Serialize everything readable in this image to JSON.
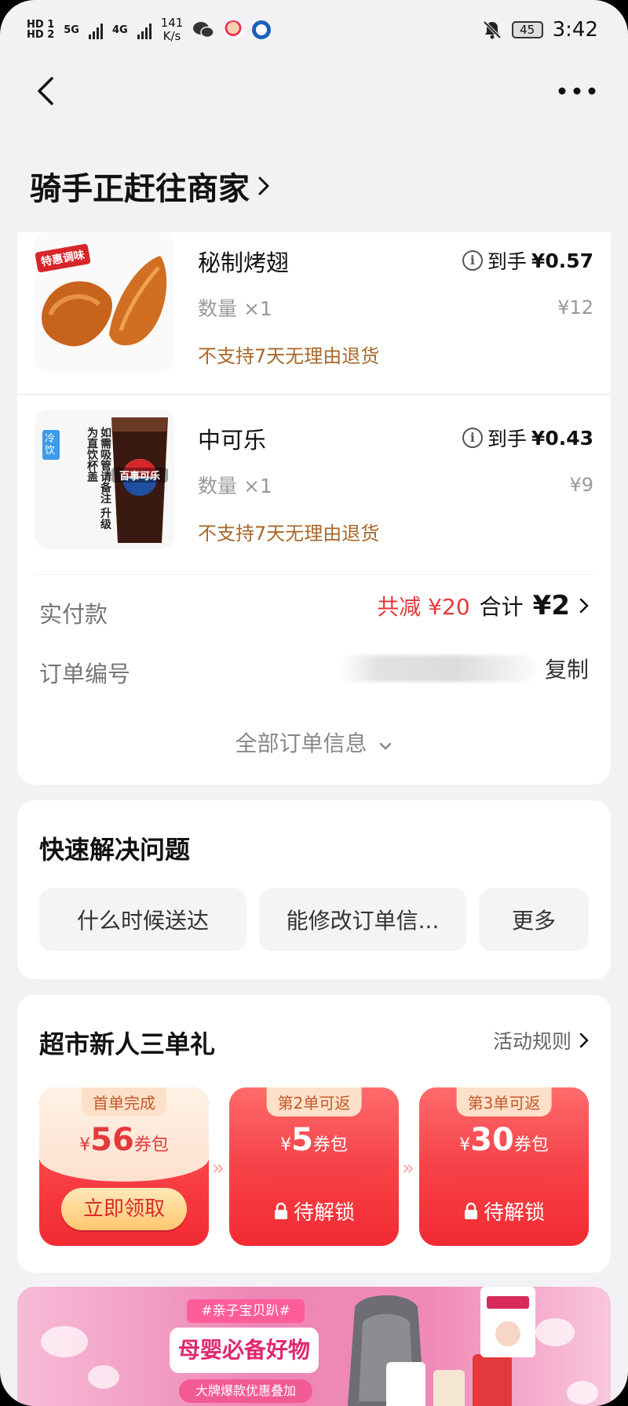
{
  "status_bar": {
    "hd1": "HD 1",
    "hd2": "HD 2",
    "net1": "5G",
    "net2": "4G",
    "speed_value": "141",
    "speed_unit": "K/s",
    "battery": "45",
    "time": "3:42",
    "icons": [
      "wechat-icon",
      "app-icon",
      "bank-icon",
      "mute-bell-icon"
    ]
  },
  "nav": {
    "back_icon": "chevron-left-icon",
    "more_icon": "more-horizontal-icon"
  },
  "header": {
    "title": "骑手正赶往商家",
    "chevron": "›"
  },
  "items": [
    {
      "name": "秘制烤翅",
      "qty": "数量 ×1",
      "net_label": "到手",
      "net_price": "¥0.57",
      "price": "¥12",
      "note": "不支持7天无理由退货",
      "image_badge": "特惠调味"
    },
    {
      "name": "中可乐",
      "qty": "数量 ×1",
      "net_label": "到手",
      "net_price": "¥0.43",
      "price": "¥9",
      "note": "不支持7天无理由退货",
      "image_badge": "冷饮",
      "image_text": "如需吸管请备注 升级为直饮杯盖",
      "cup_label": "百事可乐"
    }
  ],
  "payment": {
    "label": "实付款",
    "discount": "共减 ¥20",
    "total_label": "合计",
    "total_value": "¥2"
  },
  "order": {
    "label": "订单编号",
    "copy": "复制"
  },
  "all_info": "全部订单信息",
  "quick": {
    "title": "快速解决问题",
    "chips": [
      "什么时候送达",
      "能修改订单信...",
      "更多"
    ]
  },
  "promo": {
    "title": "超市新人三单礼",
    "rules": "活动规则",
    "coupons": [
      {
        "tag": "首单完成",
        "currency": "¥",
        "amount": "56",
        "unit": "券包",
        "action": "立即领取",
        "locked": false
      },
      {
        "tag": "第2单可返",
        "currency": "¥",
        "amount": "5",
        "unit": "券包",
        "action": "待解锁",
        "locked": true
      },
      {
        "tag": "第3单可返",
        "currency": "¥",
        "amount": "30",
        "unit": "券包",
        "action": "待解锁",
        "locked": true
      }
    ]
  },
  "banner": {
    "tag": "#亲子宝贝趴#",
    "title": "母婴必备好物",
    "subtitle": "大牌爆款优惠叠加"
  },
  "colors": {
    "accent_red": "#e4393c",
    "note_brown": "#a8672a",
    "background": "#f2f2f4"
  }
}
